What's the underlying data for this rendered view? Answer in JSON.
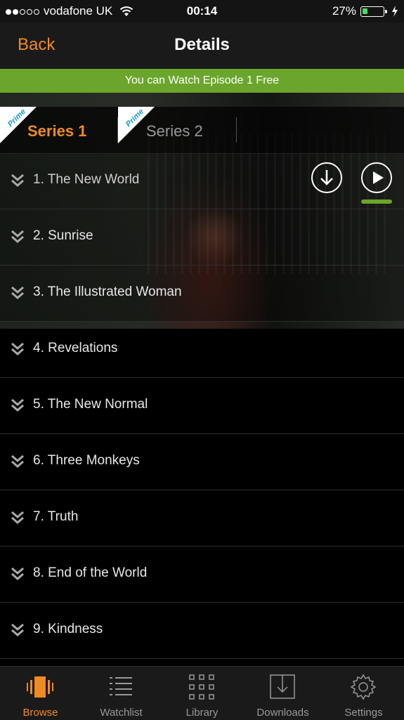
{
  "status_bar": {
    "carrier": "vodafone UK",
    "time": "00:14",
    "battery_percent": "27%",
    "battery_level": 0.27,
    "signal_bars_filled": 2,
    "signal_bars_total": 5
  },
  "nav": {
    "back_label": "Back",
    "title": "Details"
  },
  "banner": {
    "text": "You can Watch Episode 1 Free"
  },
  "tabs": [
    {
      "label": "Series 1",
      "badge": "Prime",
      "active": true
    },
    {
      "label": "Series 2",
      "badge": "Prime",
      "active": false
    }
  ],
  "episodes": [
    {
      "title": "1. The New World"
    },
    {
      "title": "2. Sunrise"
    },
    {
      "title": "3. The Illustrated Woman"
    },
    {
      "title": "4. Revelations"
    },
    {
      "title": "5. The New Normal"
    },
    {
      "title": "6. Three Monkeys"
    },
    {
      "title": "7. Truth"
    },
    {
      "title": "8. End of the World"
    },
    {
      "title": "9. Kindness"
    }
  ],
  "tab_bar": [
    {
      "label": "Browse",
      "icon": "browse-icon",
      "active": true
    },
    {
      "label": "Watchlist",
      "icon": "watchlist-icon",
      "active": false
    },
    {
      "label": "Library",
      "icon": "library-grid-icon",
      "active": false
    },
    {
      "label": "Downloads",
      "icon": "downloads-icon",
      "active": false
    },
    {
      "label": "Settings",
      "icon": "gear-icon",
      "active": false
    }
  ],
  "colors": {
    "accent": "#f08a24",
    "banner": "#6ba52b",
    "prime_blue": "#1a98d5"
  }
}
